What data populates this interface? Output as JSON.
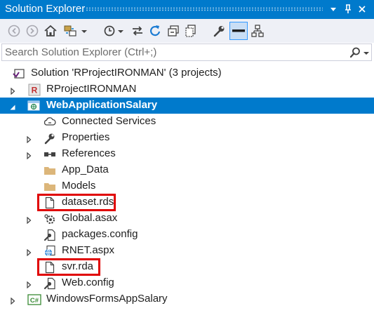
{
  "window": {
    "title": "Solution Explorer",
    "dropdown_icon": "chevron-down-icon",
    "pin_icon": "pin-icon",
    "close_icon": "close-icon"
  },
  "toolbar": {
    "buttons": [
      "back-icon",
      "forward-icon",
      "home-icon",
      "switch-views-icon",
      "history-icon",
      "sync-icon",
      "refresh-icon",
      "collapse-all-icon",
      "show-all-files-icon",
      "properties-icon",
      "preview-icon",
      "class-diagram-icon"
    ]
  },
  "search": {
    "placeholder": "Search Solution Explorer (Ctrl+;)",
    "value": ""
  },
  "tree": {
    "solution": "Solution 'RProjectIRONMAN' (3 projects)",
    "project_r": "RProjectIRONMAN",
    "project_web": "WebApplicationSalary",
    "items": {
      "connected_services": "Connected Services",
      "properties": "Properties",
      "references": "References",
      "app_data": "App_Data",
      "models": "Models",
      "dataset": "dataset.rds",
      "global": "Global.asax",
      "packages": "packages.config",
      "rnet": "RNET.aspx",
      "svr": "svr.rda",
      "webconfig": "Web.config"
    },
    "project_winforms": "WindowsFormsAppSalary",
    "icons": {
      "r_project_badge": "R",
      "csharp_badge": "C#"
    }
  },
  "colors": {
    "accent": "#007acc",
    "highlight_box": "#e00000",
    "toolbar_bg": "#eef0f6"
  }
}
